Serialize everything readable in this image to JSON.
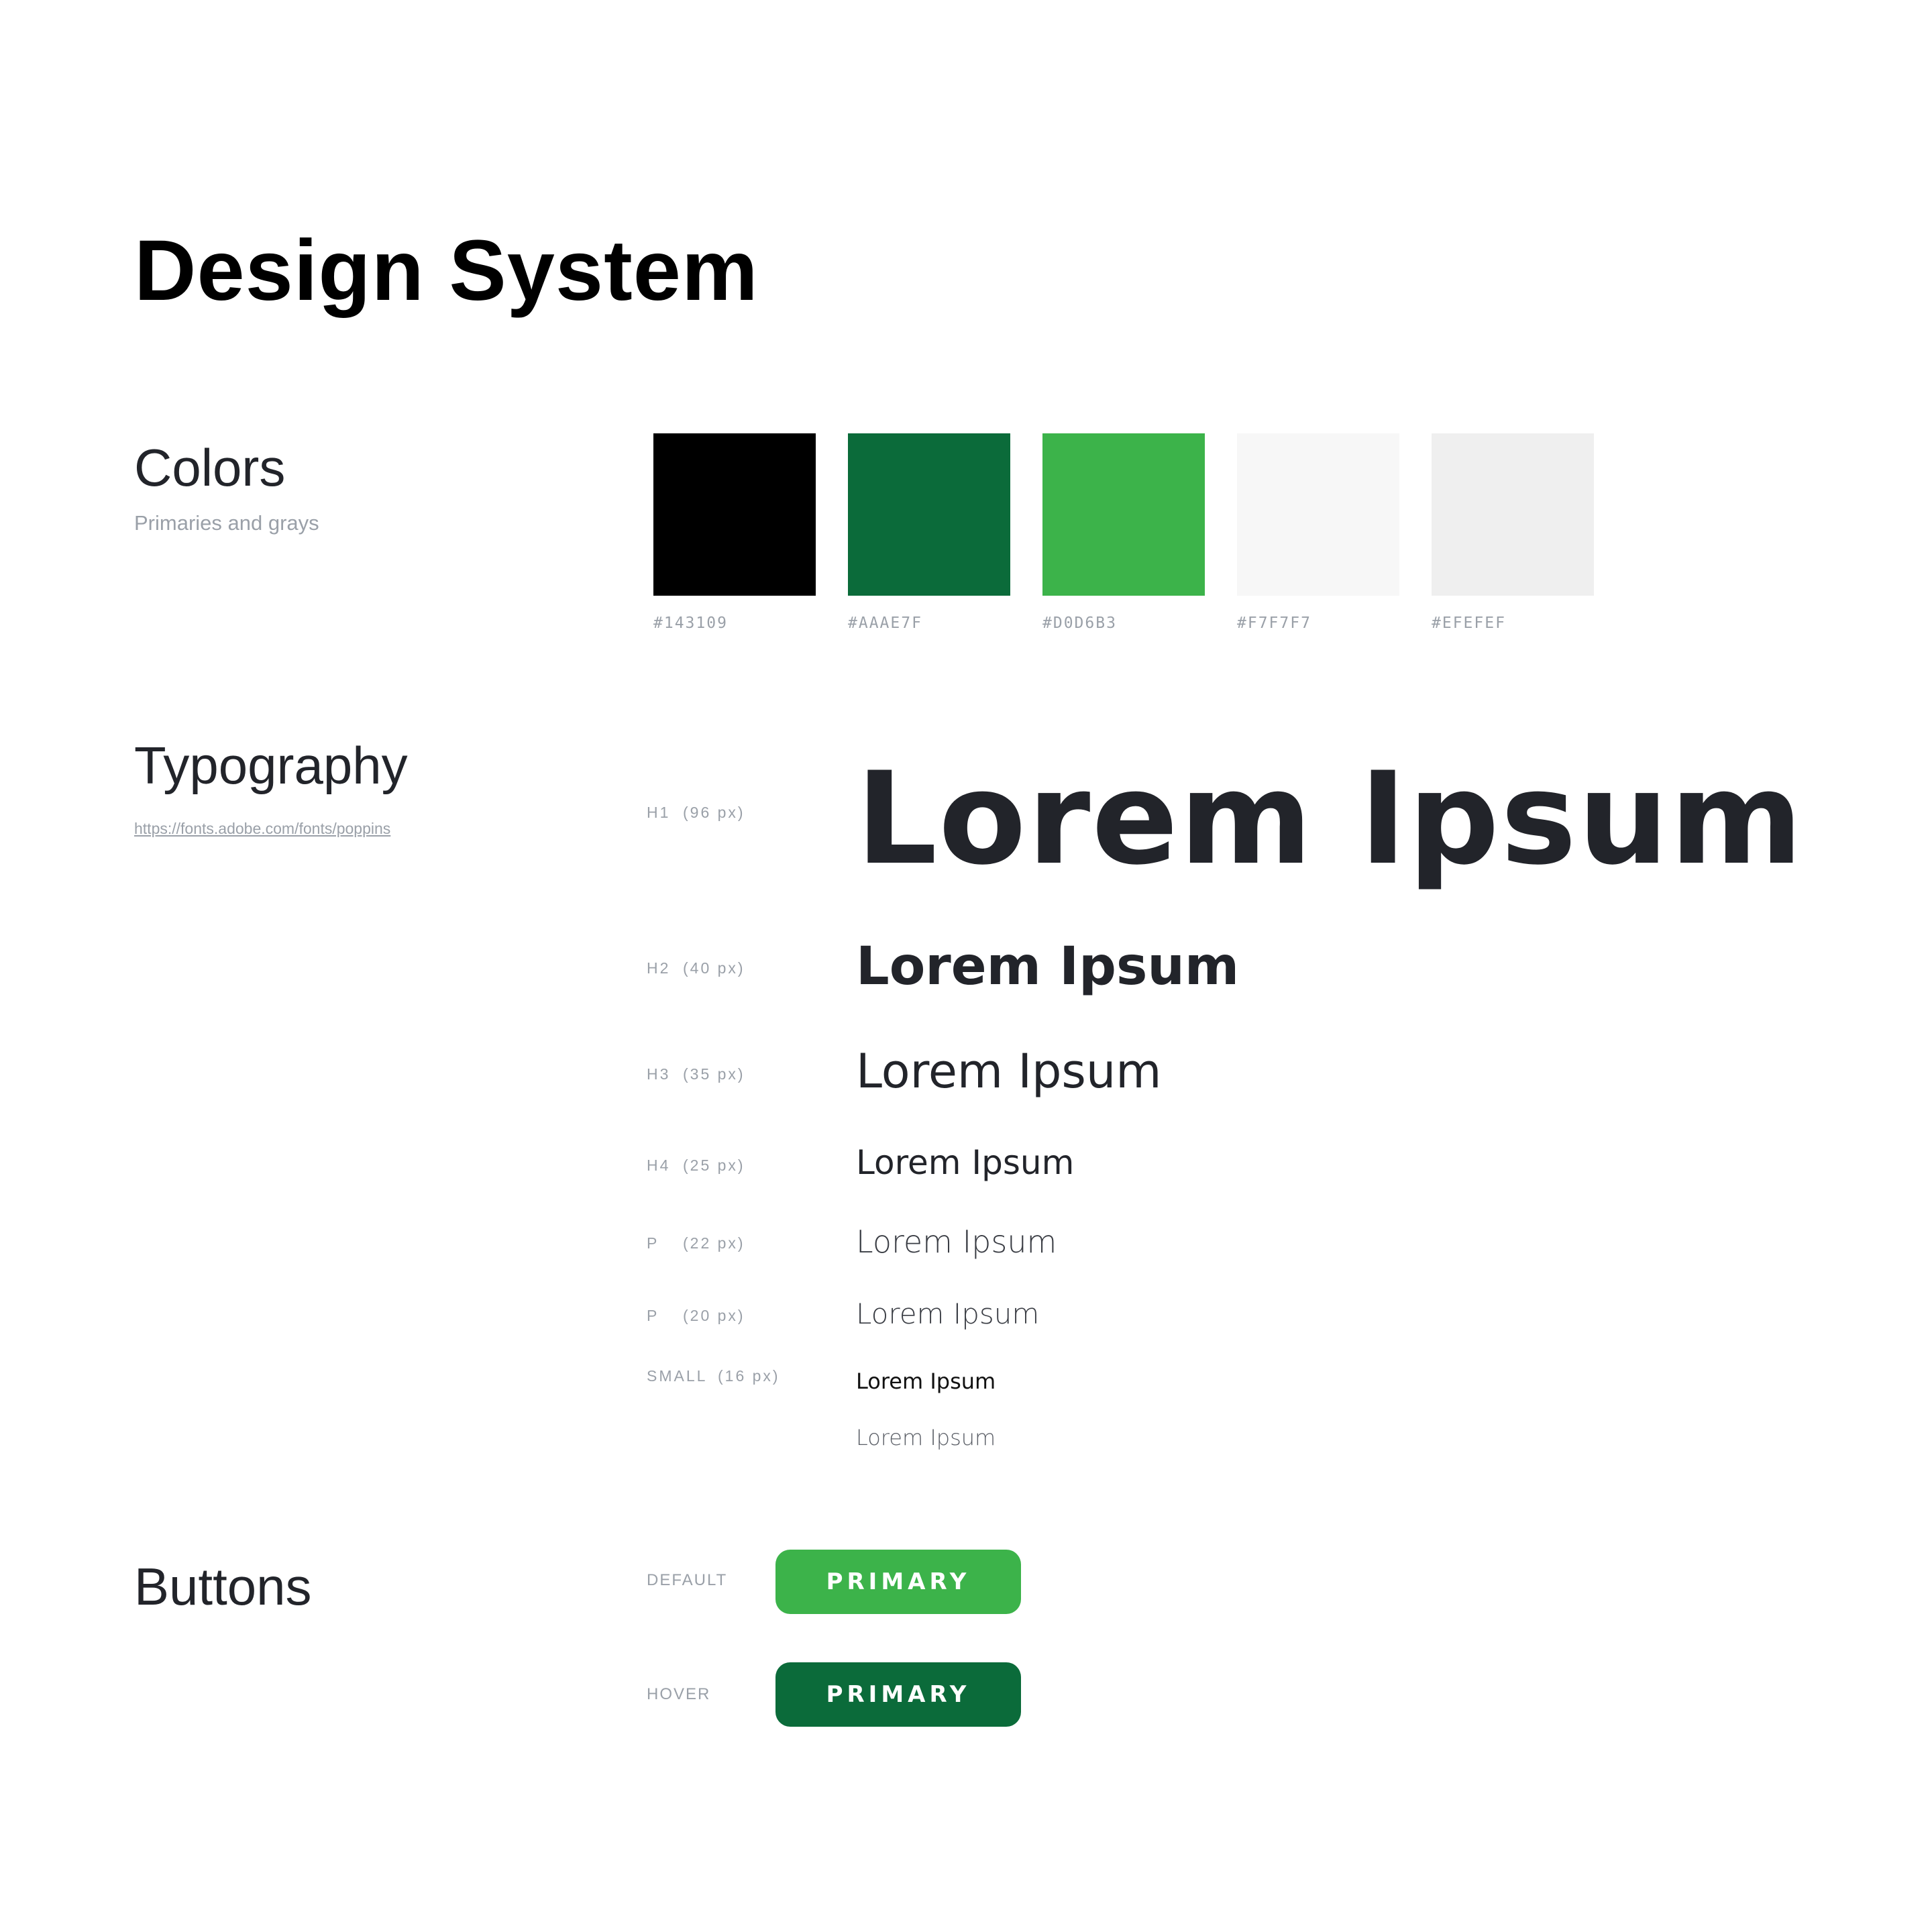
{
  "page": {
    "title": "Design System"
  },
  "colors": {
    "heading": "Colors",
    "subtitle": "Primaries and grays",
    "swatches": [
      {
        "code": "#143109",
        "fill": "#000000"
      },
      {
        "code": "#AAAE7F",
        "fill": "#0b6b3a"
      },
      {
        "code": "#D0D6B3",
        "fill": "#3cb34a"
      },
      {
        "code": "#F7F7F7",
        "fill": "#f7f7f7"
      },
      {
        "code": "#EFEFEF",
        "fill": "#efefef"
      }
    ]
  },
  "typography": {
    "heading": "Typography",
    "link": "https://fonts.adobe.com/fonts/poppins",
    "rows": [
      {
        "tag": "H1",
        "size": "(96 px)",
        "sample": "Lorem Ipsum"
      },
      {
        "tag": "H2",
        "size": "(40 px)",
        "sample": "Lorem Ipsum"
      },
      {
        "tag": "H3",
        "size": "(35 px)",
        "sample": "Lorem Ipsum"
      },
      {
        "tag": "H4",
        "size": "(25 px)",
        "sample": "Lorem Ipsum"
      },
      {
        "tag": "P",
        "size": "(22 px)",
        "sample": "Lorem Ipsum"
      },
      {
        "tag": "P",
        "size": "(20 px)",
        "sample": "Lorem Ipsum"
      },
      {
        "tag": "SMALL",
        "size": "(16 px)",
        "sample": "Lorem Ipsum"
      }
    ],
    "extra_sample": "Lorem Ipsum"
  },
  "buttons": {
    "heading": "Buttons",
    "default_label": "DEFAULT",
    "hover_label": "HOVER",
    "default_text": "PRIMARY",
    "hover_text": "PRIMARY",
    "default_color": "#3cb34a",
    "hover_color": "#0b6b3a"
  }
}
